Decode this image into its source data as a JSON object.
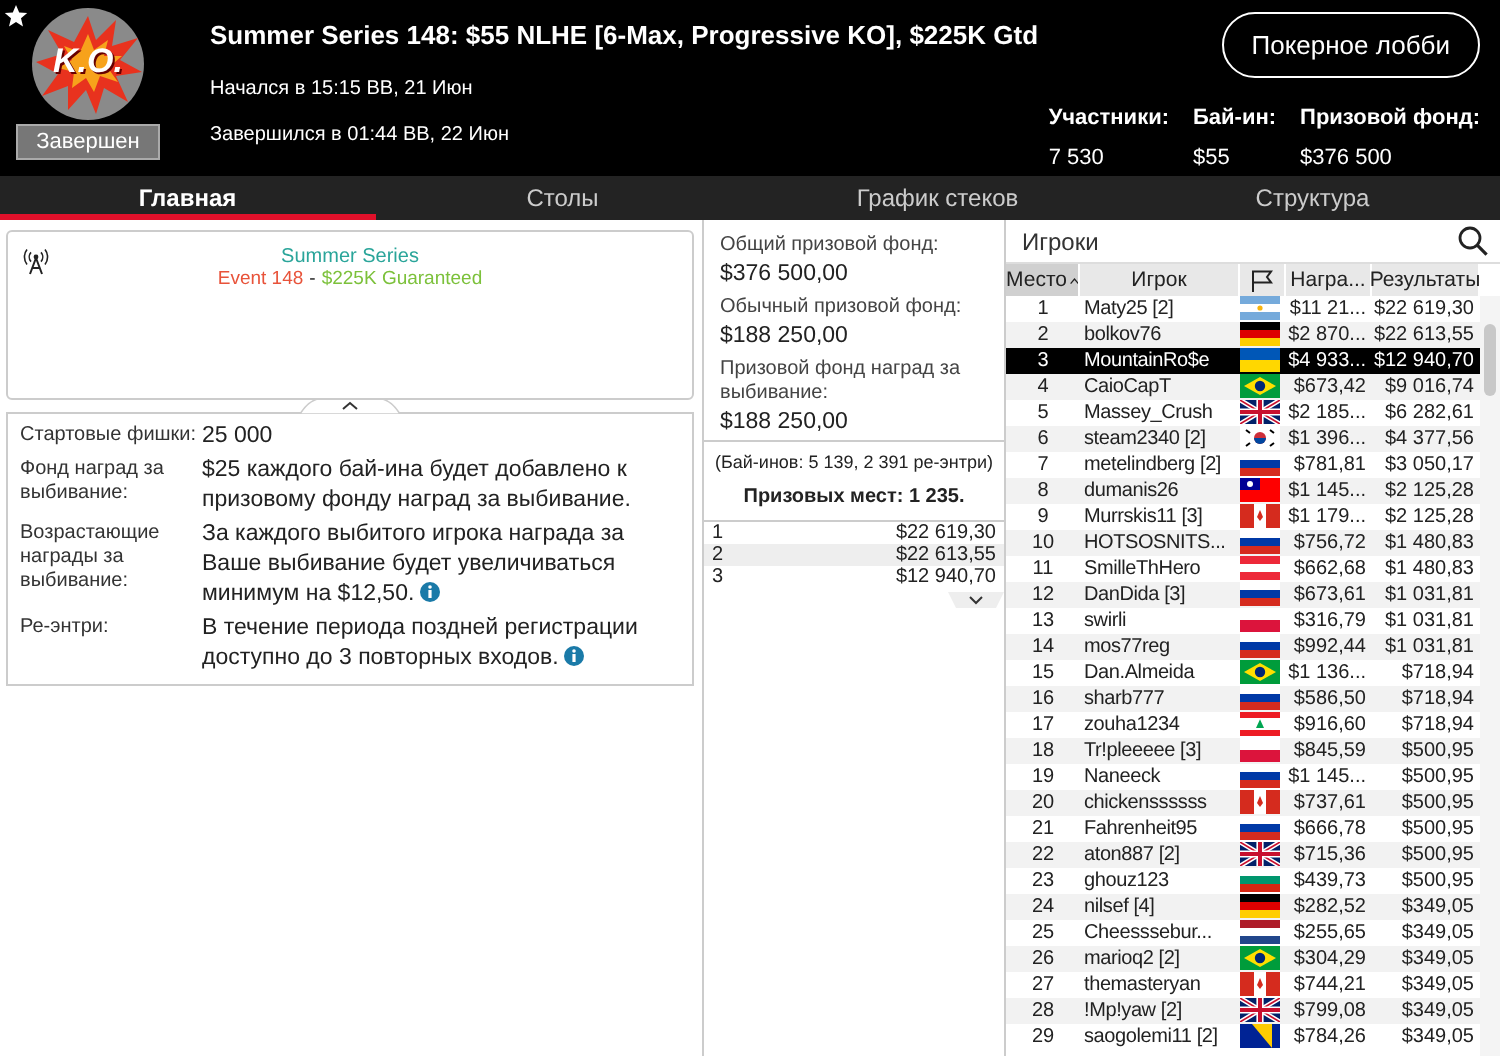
{
  "header": {
    "logo_text": "K.O.",
    "status": "Завершен",
    "title": "Summer Series 148: $55 NLHE [6-Max, Progressive KO], $225K Gtd",
    "started": "Начался в 15:15 ВВ, 21 Июн",
    "ended": "Завершился в 01:44 ВВ, 22 Июн",
    "lobby_button": "Покерное лобби",
    "stats": [
      {
        "label": "Участники:",
        "value": "7 530"
      },
      {
        "label": "Бай-ин:",
        "value": "$55"
      },
      {
        "label": "Призовой фонд:",
        "value": "$376 500"
      }
    ]
  },
  "tabs": [
    {
      "label": "Главная",
      "selected": true
    },
    {
      "label": "Столы",
      "selected": false
    },
    {
      "label": "График стеков",
      "selected": false
    },
    {
      "label": "Структура",
      "selected": false
    }
  ],
  "banner": {
    "title": "Summer Series",
    "event": "Event 148",
    "separator": "-",
    "guarantee": "$225K Guaranteed"
  },
  "details": [
    {
      "label": "Стартовые фишки:",
      "value": "25 000",
      "info_icon": false
    },
    {
      "label": "Фонд наград за выбивание:",
      "value": "$25 каждого бай-ина будет добавлено к призовому фонду наград за выбивание.",
      "info_icon": false
    },
    {
      "label": "Возрастающие награды за выбивание:",
      "value": "За каждого выбитого игрока награда за Ваше выбивание будет увеличиваться минимум на $12,50.",
      "info_icon": true
    },
    {
      "label": "Ре-энтри:",
      "value": "В течение периода поздней регистрации доступно до 3 повторных входов.",
      "info_icon": true
    }
  ],
  "prize_pools": [
    {
      "label": "Общий призовой фонд:",
      "value": "$376 500,00"
    },
    {
      "label": "Обычный призовой фонд:",
      "value": "$188 250,00"
    },
    {
      "label": "Призовой фонд наград за выбивание:",
      "value": "$188 250,00"
    }
  ],
  "entries_note": "(Бай-инов: 5 139, 2 391 ре-энтри)",
  "paid_places": "Призовых мест: 1 235.",
  "payouts": [
    {
      "place": "1",
      "amount": "$22 619,30"
    },
    {
      "place": "2",
      "amount": "$22 613,55"
    },
    {
      "place": "3",
      "amount": "$12 940,70"
    }
  ],
  "players": {
    "search": {
      "placeholder": "Игроки"
    },
    "columns": [
      {
        "kind": "text",
        "label": "Место",
        "sorted": true
      },
      {
        "kind": "text",
        "label": "Игрок",
        "sorted": false
      },
      {
        "kind": "flag",
        "sorted": false
      },
      {
        "kind": "text",
        "label": "Награ...",
        "sorted": false
      },
      {
        "kind": "text",
        "label": "Результаты",
        "sorted": false
      }
    ],
    "rows": [
      {
        "place": "1",
        "player": "Maty25 [2]",
        "kind": "argentina",
        "bounty": "$11 21...",
        "result": "$22 619,30",
        "selected": false
      },
      {
        "place": "2",
        "player": "bolkov76",
        "kind": "germany",
        "bounty": "$2 870...",
        "result": "$22 613,55",
        "selected": false
      },
      {
        "place": "3",
        "player": "MountainRo$e",
        "kind": "ukraine",
        "bounty": "$4 933...",
        "result": "$12 940,70",
        "selected": true
      },
      {
        "place": "4",
        "player": "CaioCapT",
        "kind": "brazil",
        "bounty": "$673,42",
        "result": "$9 016,74",
        "selected": false
      },
      {
        "place": "5",
        "player": "Massey_Crush",
        "kind": "britain",
        "bounty": "$2 185...",
        "result": "$6 282,61",
        "selected": false
      },
      {
        "place": "6",
        "player": "steam2340 [2]",
        "kind": "korea",
        "bounty": "$1 396...",
        "result": "$4 377,56",
        "selected": false
      },
      {
        "place": "7",
        "player": "metelindberg [2]",
        "kind": "russia",
        "bounty": "$781,81",
        "result": "$3 050,17",
        "selected": false
      },
      {
        "place": "8",
        "player": "dumanis26",
        "kind": "taiwan",
        "bounty": "$1 145...",
        "result": "$2 125,28",
        "selected": false
      },
      {
        "place": "9",
        "player": "Murrskis11 [3]",
        "kind": "canada",
        "bounty": "$1 179...",
        "result": "$2 125,28",
        "selected": false
      },
      {
        "place": "10",
        "player": "HOTSOSNITS...",
        "kind": "russia",
        "bounty": "$756,72",
        "result": "$1 480,83",
        "selected": false
      },
      {
        "place": "11",
        "player": "SmilleThHero",
        "kind": "austria",
        "bounty": "$662,68",
        "result": "$1 480,83",
        "selected": false
      },
      {
        "place": "12",
        "player": "DanDida [3]",
        "kind": "russia",
        "bounty": "$673,61",
        "result": "$1 031,81",
        "selected": false
      },
      {
        "place": "13",
        "player": "swirli",
        "kind": "poland",
        "bounty": "$316,79",
        "result": "$1 031,81",
        "selected": false
      },
      {
        "place": "14",
        "player": "mos77reg",
        "kind": "russia",
        "bounty": "$992,44",
        "result": "$1 031,81",
        "selected": false
      },
      {
        "place": "15",
        "player": "Dan.Almeida",
        "kind": "brazil",
        "bounty": "$1 136...",
        "result": "$718,94",
        "selected": false
      },
      {
        "place": "16",
        "player": "sharb777",
        "kind": "russia",
        "bounty": "$586,50",
        "result": "$718,94",
        "selected": false
      },
      {
        "place": "17",
        "player": "zouha1234",
        "kind": "lebanon",
        "bounty": "$916,60",
        "result": "$718,94",
        "selected": false
      },
      {
        "place": "18",
        "player": "Tr!pleeeee [3]",
        "kind": "poland",
        "bounty": "$845,59",
        "result": "$500,95",
        "selected": false
      },
      {
        "place": "19",
        "player": "Naneeck",
        "kind": "russia",
        "bounty": "$1 145...",
        "result": "$500,95",
        "selected": false
      },
      {
        "place": "20",
        "player": "chickenssssss",
        "kind": "canada",
        "bounty": "$737,61",
        "result": "$500,95",
        "selected": false
      },
      {
        "place": "21",
        "player": "Fahrenheit95",
        "kind": "russia",
        "bounty": "$666,78",
        "result": "$500,95",
        "selected": false
      },
      {
        "place": "22",
        "player": "aton887 [2]",
        "kind": "britain",
        "bounty": "$715,36",
        "result": "$500,95",
        "selected": false
      },
      {
        "place": "23",
        "player": "ghouz123",
        "kind": "bulgaria",
        "bounty": "$439,73",
        "result": "$500,95",
        "selected": false
      },
      {
        "place": "24",
        "player": "nilsef [4]",
        "kind": "germany",
        "bounty": "$282,52",
        "result": "$349,05",
        "selected": false
      },
      {
        "place": "25",
        "player": "Cheesssebur...",
        "kind": "netherlands",
        "bounty": "$255,65",
        "result": "$349,05",
        "selected": false
      },
      {
        "place": "26",
        "player": "marioq2 [2]",
        "kind": "brazil",
        "bounty": "$304,29",
        "result": "$349,05",
        "selected": false
      },
      {
        "place": "27",
        "player": "themasteryan",
        "kind": "canada",
        "bounty": "$744,21",
        "result": "$349,05",
        "selected": false
      },
      {
        "place": "28",
        "player": "!Mp!yaw [2]",
        "kind": "britain",
        "bounty": "$799,08",
        "result": "$349,05",
        "selected": false
      },
      {
        "place": "29",
        "player": "saogolemi11 [2]",
        "kind": "bosnia",
        "bounty": "$784,26",
        "result": "$349,05",
        "selected": false
      }
    ]
  }
}
